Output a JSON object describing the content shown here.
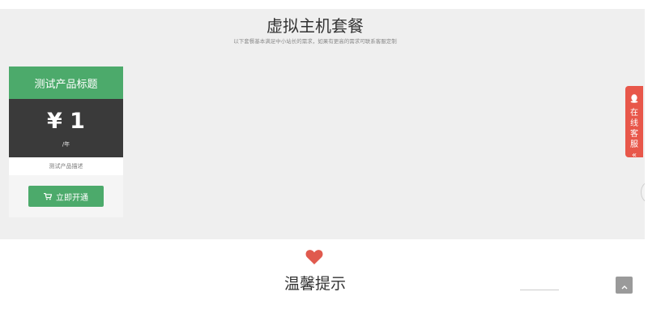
{
  "section": {
    "title": "虚拟主机套餐",
    "subtitle": "以下套餐基本满足中小站长的需求，如果有更高的需求可联系客服定制"
  },
  "plan": {
    "name": "测试产品标题",
    "price": "¥ 1",
    "period": "/年",
    "description": "测试产品描述",
    "button_label": "立即开通"
  },
  "side_chat": {
    "label": "在线客服",
    "arrows": "«"
  },
  "tips": {
    "title": "温馨提示"
  },
  "icons": {
    "cart": "cart-icon",
    "heart": "heart-icon",
    "qq": "qq-icon",
    "back_top": "chevron-up-icon"
  },
  "colors": {
    "accent_green": "#4caa6b",
    "price_bg": "#3a3a3a",
    "chat_red": "#e8574a",
    "heart_red": "#e05a4e"
  }
}
